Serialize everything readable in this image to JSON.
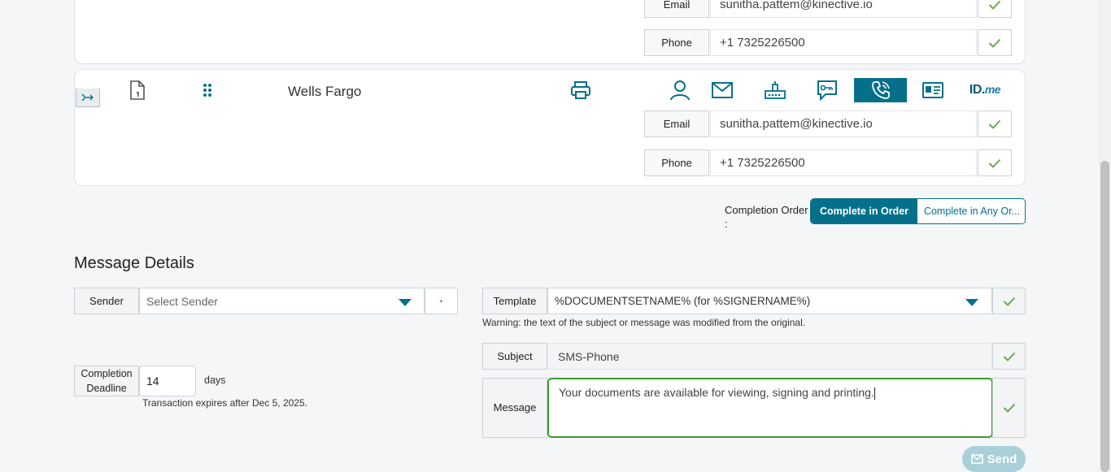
{
  "signer_card_1": {
    "email_label": "Email",
    "email_value": "sunitha.pattem@kinective.io",
    "phone_label": "Phone",
    "phone_value": "+1 7325226500"
  },
  "signer_card_2": {
    "bank_name": "Wells Fargo",
    "auth_methods": [
      "user-icon",
      "envelope-icon",
      "router-icon",
      "key-chat-icon",
      "phone-icon",
      "id-card-icon",
      "idme-logo"
    ],
    "active_auth": "phone-icon",
    "idme_text": "ID.",
    "idme_suffix": "me",
    "email_label": "Email",
    "email_value": "sunitha.pattem@kinective.io",
    "phone_label": "Phone",
    "phone_value": "+1 7325226500"
  },
  "completion_order": {
    "label": "Completion Order",
    "colon": ":",
    "options": [
      "Complete in Order",
      "Complete in Any Or..."
    ],
    "selected": "Complete in Order"
  },
  "message_details": {
    "title": "Message Details",
    "sender_label": "Sender",
    "sender_placeholder": "Select Sender",
    "required_marker": "•",
    "deadline_label_line1": "Completion",
    "deadline_label_line2": "Deadline",
    "deadline_value": "14",
    "deadline_unit": "days",
    "expiry_note": "Transaction expires after Dec 5, 2025.",
    "template_label": "Template",
    "template_value": "%DOCUMENTSETNAME% (for %SIGNERNAME%)",
    "warning": "Warning: the text of the subject or message was modified from the original.",
    "subject_label": "Subject",
    "subject_value": "SMS-Phone",
    "message_label": "Message",
    "message_value": "Your documents are available for viewing, signing and printing.",
    "send_label": "Send"
  },
  "colors": {
    "accent": "#06708a",
    "check": "#6aa84f",
    "focus_border": "#3c9a2c",
    "send_disabled": "#a9cfd8"
  }
}
